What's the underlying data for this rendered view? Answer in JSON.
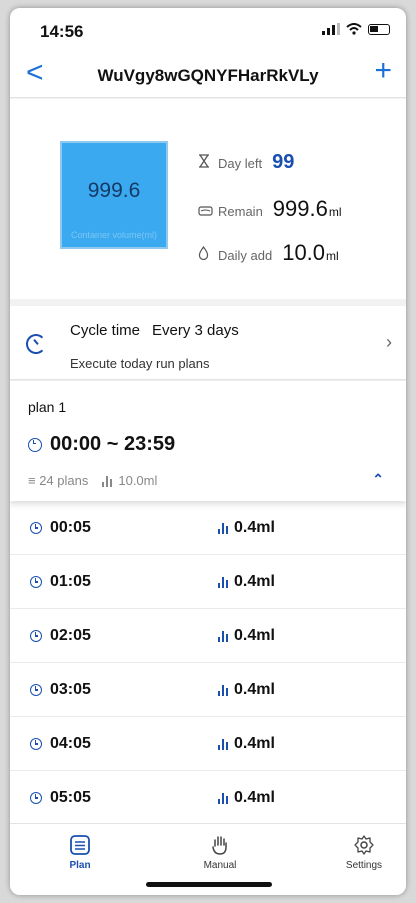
{
  "status_bar": {
    "time": "14:56"
  },
  "nav": {
    "title": "WuVgy8wGQNYFHarRkVLy",
    "back_glyph": "<",
    "add_glyph": "+"
  },
  "container": {
    "volume": "999.6",
    "caption": "Container volume(ml)",
    "day_left_label": "Day left",
    "day_left_value": "99",
    "remain_label": "Remain",
    "remain_value": "999.6",
    "remain_unit": "ml",
    "daily_add_label": "Daily add",
    "daily_add_value": "10.0",
    "daily_add_unit": "ml"
  },
  "cycle": {
    "label": "Cycle time",
    "value": "Every 3 days",
    "sub": "Execute today run plans"
  },
  "plan": {
    "name": "plan 1",
    "range": "00:00 ~ 23:59",
    "count": "24 plans",
    "total": "10.0ml"
  },
  "schedule": [
    {
      "time": "00:05",
      "amount": "0.4ml"
    },
    {
      "time": "01:05",
      "amount": "0.4ml"
    },
    {
      "time": "02:05",
      "amount": "0.4ml"
    },
    {
      "time": "03:05",
      "amount": "0.4ml"
    },
    {
      "time": "04:05",
      "amount": "0.4ml"
    },
    {
      "time": "05:05",
      "amount": "0.4ml"
    }
  ],
  "tabs": {
    "plan": "Plan",
    "manual": "Manual",
    "settings": "Settings"
  },
  "colors": {
    "accent": "#1a4fb0",
    "link": "#1a6fd8",
    "tank": "#3aa9ef"
  },
  "icons": {
    "day_left": "hourglass-icon",
    "remain": "tank-icon",
    "daily_add": "drop-icon"
  }
}
